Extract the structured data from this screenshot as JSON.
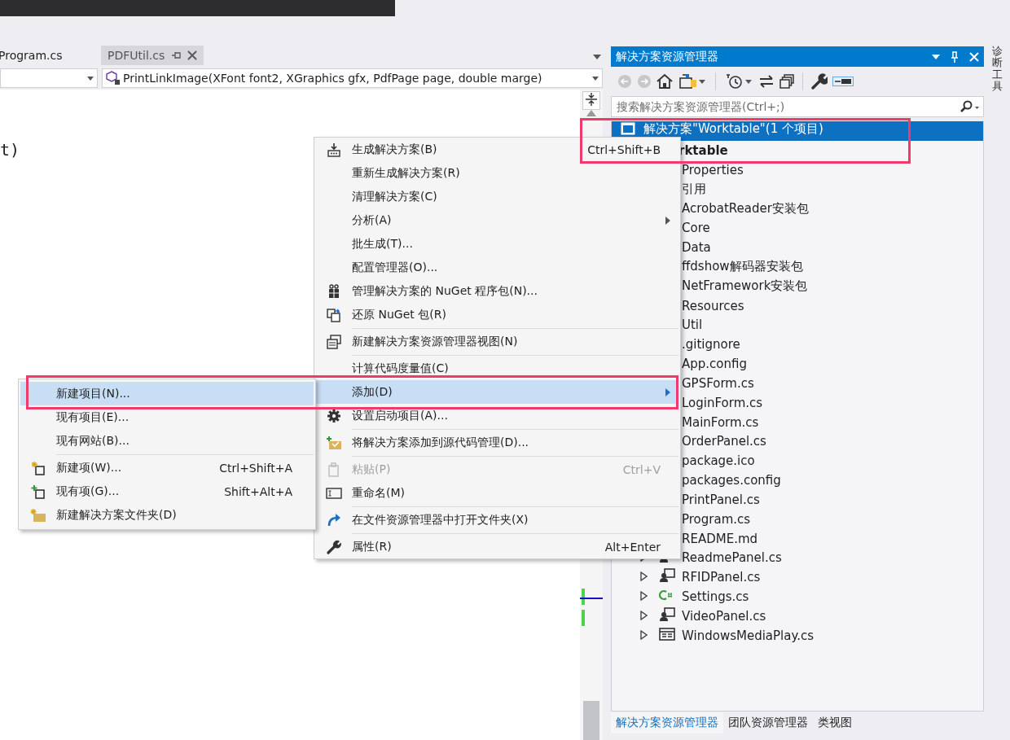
{
  "side_tab": "诊断工具",
  "editor": {
    "tabs": [
      {
        "label": "Program.cs",
        "selected": false
      },
      {
        "label": "PDFUtil.cs",
        "selected": true
      }
    ],
    "member_combo": "PrintLinkImage(XFont font2, XGraphics gfx, PdfPage page, double marge)",
    "code_lines": [
      "t)"
    ]
  },
  "solution_explorer": {
    "title": "解决方案资源管理器",
    "preview_toggle": {
      "on": true
    },
    "search": {
      "placeholder": "搜索解决方案资源管理器(Ctrl+;)"
    },
    "tree": [
      {
        "label": "解决方案\"Worktable\"(1 个项目)",
        "kind": "solution",
        "selected": true,
        "children": [
          {
            "label": "rktable",
            "startup": true,
            "selected": false,
            "children": [
              {
                "label": "Properties",
                "selected": false
              },
              {
                "label": "引用",
                "selected": false
              },
              {
                "label": "AcrobatReader安装包",
                "selected": false
              },
              {
                "label": "Core",
                "selected": false
              },
              {
                "label": "Data",
                "selected": false
              },
              {
                "label": "ffdshow解码器安装包",
                "selected": false
              },
              {
                "label": "NetFramework安装包",
                "selected": false
              },
              {
                "label": "Resources",
                "selected": false
              },
              {
                "label": "Util",
                "selected": false
              },
              {
                "label": ".gitignore",
                "selected": false
              },
              {
                "label": "App.config",
                "selected": false
              },
              {
                "label": "GPSForm.cs",
                "selected": false
              },
              {
                "label": "LoginForm.cs",
                "selected": false
              },
              {
                "label": "MainForm.cs",
                "selected": false
              },
              {
                "label": "OrderPanel.cs",
                "selected": false
              },
              {
                "label": "package.ico",
                "selected": false
              },
              {
                "label": "packages.config",
                "selected": false
              },
              {
                "label": "PrintPanel.cs",
                "selected": false
              },
              {
                "label": "Program.cs",
                "selected": false
              },
              {
                "label": "README.md",
                "selected": false
              },
              {
                "label": "ReadmePanel.cs",
                "kind": "usercontrol",
                "expanded": false,
                "selected": false
              },
              {
                "label": "RFIDPanel.cs",
                "kind": "usercontrol",
                "expanded": false,
                "selected": false
              },
              {
                "label": "Settings.cs",
                "kind": "csharp",
                "expanded": false,
                "selected": false
              },
              {
                "label": "VideoPanel.cs",
                "kind": "usercontrol",
                "expanded": false,
                "selected": false
              },
              {
                "label": "WindowsMediaPlay.cs",
                "kind": "form",
                "expanded": false,
                "selected": false
              }
            ]
          }
        ]
      }
    ],
    "bottom_tabs": [
      {
        "label": "解决方案资源管理器",
        "selected": true
      },
      {
        "label": "团队资源管理器",
        "selected": false
      },
      {
        "label": "类视图",
        "selected": false
      }
    ]
  },
  "context_menu": {
    "items": [
      {
        "kind": "item",
        "label": "生成解决方案(B)",
        "shortcut": "Ctrl+Shift+B",
        "submenu": false,
        "disabled": false,
        "selected": false
      },
      {
        "kind": "item",
        "label": "重新生成解决方案(R)",
        "submenu": false,
        "disabled": false,
        "selected": false
      },
      {
        "kind": "item",
        "label": "清理解决方案(C)",
        "submenu": false,
        "disabled": false,
        "selected": false
      },
      {
        "kind": "item",
        "label": "分析(A)",
        "submenu": true,
        "disabled": false,
        "selected": false
      },
      {
        "kind": "item",
        "label": "批生成(T)...",
        "submenu": false,
        "disabled": false,
        "selected": false
      },
      {
        "kind": "item",
        "label": "配置管理器(O)...",
        "submenu": false,
        "disabled": false,
        "selected": false
      },
      {
        "kind": "item",
        "label": "管理解决方案的 NuGet 程序包(N)...",
        "submenu": false,
        "disabled": false,
        "selected": false
      },
      {
        "kind": "item",
        "label": "还原 NuGet 包(R)",
        "submenu": false,
        "disabled": false,
        "selected": false
      },
      {
        "kind": "separator"
      },
      {
        "kind": "item",
        "label": "新建解决方案资源管理器视图(N)",
        "submenu": false,
        "disabled": false,
        "selected": false
      },
      {
        "kind": "separator"
      },
      {
        "kind": "item",
        "label": "计算代码度量值(C)",
        "submenu": false,
        "disabled": false,
        "selected": false
      },
      {
        "kind": "item",
        "label": "添加(D)",
        "submenu": true,
        "disabled": false,
        "selected": true
      },
      {
        "kind": "item",
        "label": "设置启动项目(A)...",
        "submenu": false,
        "disabled": false,
        "selected": false
      },
      {
        "kind": "separator"
      },
      {
        "kind": "item",
        "label": "将解决方案添加到源代码管理(D)...",
        "submenu": false,
        "disabled": false,
        "selected": false
      },
      {
        "kind": "separator"
      },
      {
        "kind": "item",
        "label": "粘贴(P)",
        "shortcut": "Ctrl+V",
        "submenu": false,
        "disabled": true,
        "selected": false
      },
      {
        "kind": "item",
        "label": "重命名(M)",
        "submenu": false,
        "disabled": false,
        "selected": false
      },
      {
        "kind": "separator"
      },
      {
        "kind": "item",
        "label": "在文件资源管理器中打开文件夹(X)",
        "submenu": false,
        "disabled": false,
        "selected": false
      },
      {
        "kind": "separator"
      },
      {
        "kind": "item",
        "label": "属性(R)",
        "shortcut": "Alt+Enter",
        "submenu": false,
        "disabled": false,
        "selected": false
      }
    ]
  },
  "add_submenu": {
    "items": [
      {
        "kind": "item",
        "label": "新建项目(N)...",
        "selected": true
      },
      {
        "kind": "item",
        "label": "现有项目(E)...",
        "selected": false
      },
      {
        "kind": "item",
        "label": "现有网站(B)...",
        "selected": false
      },
      {
        "kind": "separator"
      },
      {
        "kind": "item",
        "label": "新建项(W)...",
        "shortcut": "Ctrl+Shift+A",
        "selected": false
      },
      {
        "kind": "item",
        "label": "现有项(G)...",
        "shortcut": "Shift+Alt+A",
        "selected": false
      },
      {
        "kind": "item",
        "label": "新建解决方案文件夹(D)",
        "selected": false
      }
    ]
  }
}
